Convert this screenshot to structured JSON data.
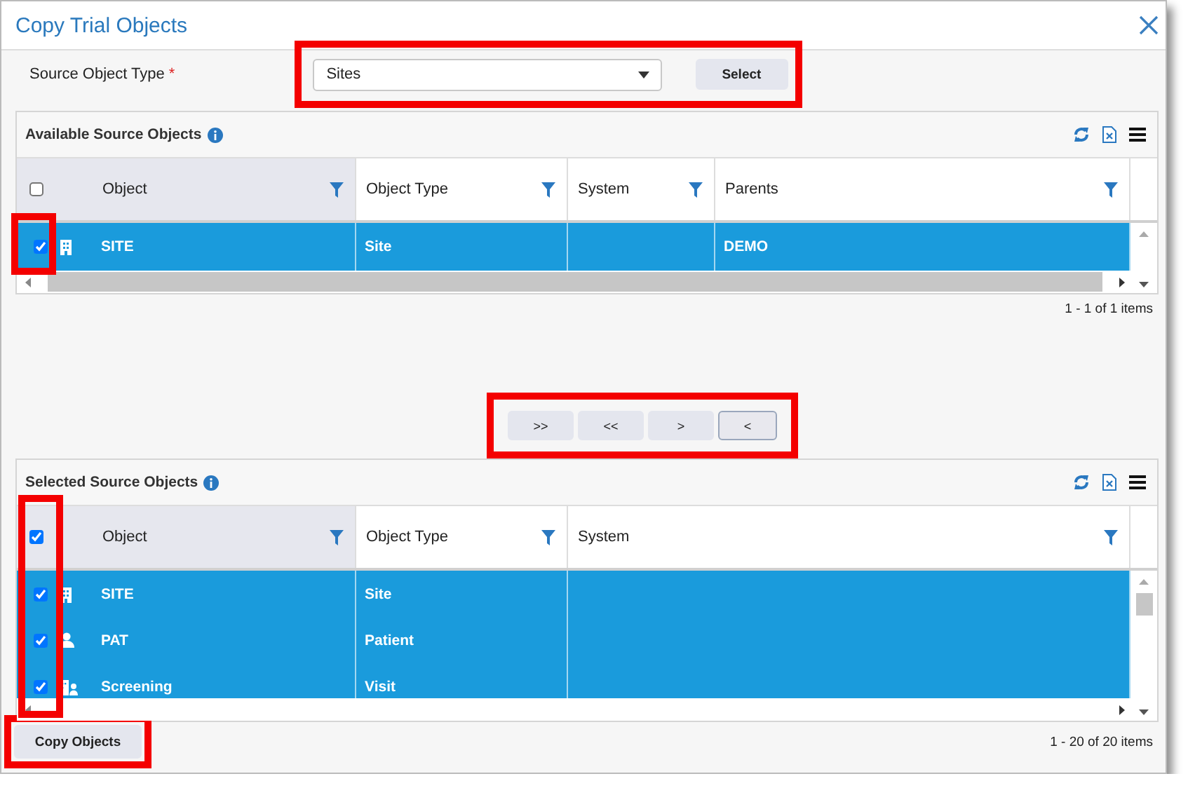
{
  "window": {
    "title": "Copy Trial Objects"
  },
  "source_type": {
    "label": "Source Object Type",
    "required_mark": "*",
    "value": "Sites",
    "highlighted": true
  },
  "select_button": {
    "label": "Select"
  },
  "available": {
    "title": "Available Source Objects",
    "all_checked": false,
    "checkbox_column_highlighted": true,
    "columns": [
      "Object",
      "Object Type",
      "System",
      "Parents"
    ],
    "rows": [
      {
        "kind": "site",
        "object": "SITE",
        "object_type": "Site",
        "parents": "DEMO",
        "checked": true,
        "selected": true
      }
    ],
    "pager": "1 - 1 of 1 items"
  },
  "move_buttons": {
    "highlighted": true,
    "buttons": [
      {
        "label": ">>",
        "focused": false
      },
      {
        "label": "<<",
        "focused": false
      },
      {
        "label": ">",
        "focused": false
      },
      {
        "label": "<",
        "focused": true
      }
    ]
  },
  "selected": {
    "title": "Selected Source Objects",
    "all_checked": true,
    "checkbox_column_highlighted": true,
    "columns": [
      "Object",
      "Object Type",
      "System"
    ],
    "rows": [
      {
        "kind": "site",
        "object": "SITE",
        "object_type": "Site",
        "checked": true,
        "selected": true
      },
      {
        "kind": "patient",
        "object": "PAT",
        "object_type": "Patient",
        "checked": true,
        "selected": true
      },
      {
        "kind": "visit",
        "object": "Screening",
        "object_type": "Visit",
        "checked": true,
        "selected": true
      }
    ],
    "pager": "1 - 20 of 20 items"
  },
  "copy_button": {
    "label": "Copy Objects",
    "highlighted": true
  }
}
